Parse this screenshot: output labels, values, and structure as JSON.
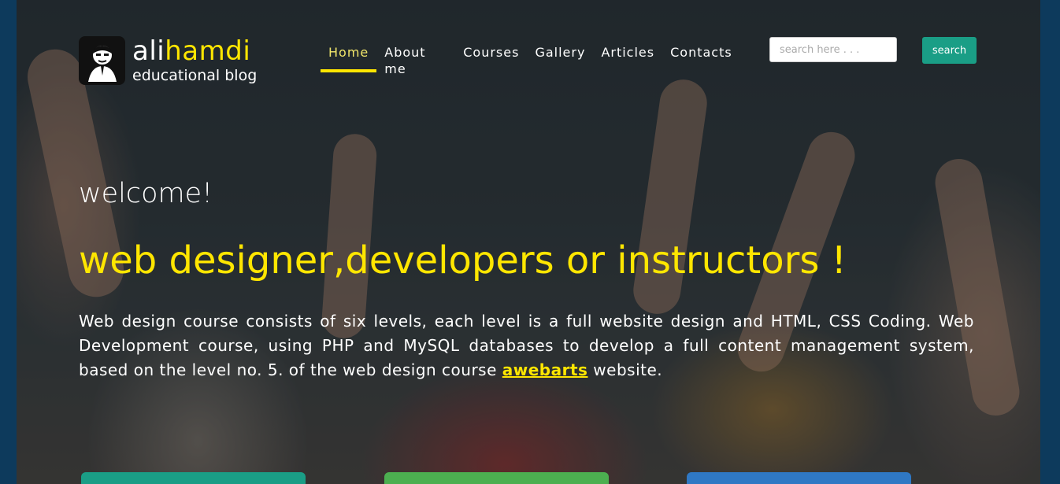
{
  "logo": {
    "name_part1": "ali",
    "name_part2": "hamdi",
    "subtitle": "educational blog",
    "icon": "portrait-icon"
  },
  "nav": {
    "items": [
      "Home",
      "About me",
      "Courses",
      "Gallery",
      "Articles",
      "Contacts"
    ],
    "active": "Home"
  },
  "search": {
    "placeholder": "search here . . .",
    "button_label": "search"
  },
  "hero": {
    "welcome": "welcome!",
    "headline": "web designer,developers or instructors !",
    "description_before": "Web design course consists of six levels, each level is a full website design and HTML, CSS Coding. Web Development course, using PHP and MySQL databases to develop a full content management system, based on the level no. 5. of the web design course ",
    "link_text": "awebarts",
    "description_after": " website."
  },
  "colors": {
    "accent": "#ffe600",
    "search_button": "#1a9e86",
    "card1": "#1a9e86",
    "card2": "#4caf50",
    "card3": "#2f78c4",
    "frame": "#0d3a5c"
  }
}
